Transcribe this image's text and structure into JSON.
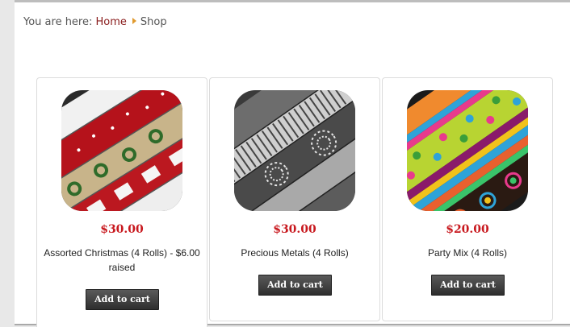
{
  "breadcrumb": {
    "prefix": "You are here:",
    "home": "Home",
    "current": "Shop"
  },
  "products": [
    {
      "price": "$30.00",
      "name": "Assorted Christmas (4 Rolls) - $6.00 raised",
      "button": "Add to cart",
      "image": "christmas-wrapping-paper-rolls"
    },
    {
      "price": "$30.00",
      "name": "Precious Metals (4 Rolls)",
      "button": "Add to cart",
      "image": "metallic-wrapping-paper-rolls"
    },
    {
      "price": "$20.00",
      "name": "Party Mix (4 Rolls)",
      "button": "Add to cart",
      "image": "party-wrapping-paper-rolls"
    }
  ],
  "colors": {
    "price": "#c8181e",
    "link": "#8a1d1d",
    "button": "#3a3a3a",
    "breadcrumb_arrow": "#e09a2e"
  }
}
